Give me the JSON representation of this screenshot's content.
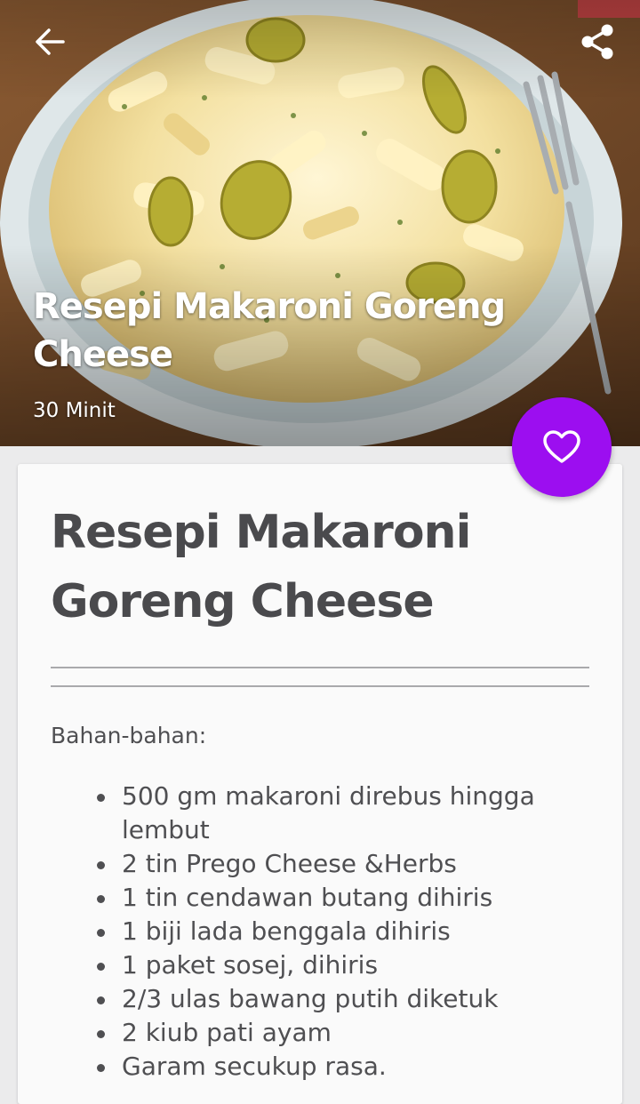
{
  "hero": {
    "title": "Resepi Makaroni Goreng Cheese",
    "duration": "30 Minit"
  },
  "toolbar": {
    "back_icon": "arrow-left-icon",
    "share_icon": "share-icon"
  },
  "favorite": {
    "icon": "heart-outline-icon",
    "color": "#9c0ef0"
  },
  "recipe": {
    "title": "Resepi Makaroni Goreng Cheese",
    "ingredients_label": "Bahan-bahan:",
    "ingredients": [
      "500 gm makaroni direbus hingga lembut",
      "2 tin Prego Cheese &Herbs",
      "1 tin cendawan butang dihiris",
      "1 biji lada benggala dihiris",
      "1 paket sosej, dihiris",
      "2/3 ulas bawang putih diketuk",
      "2 kiub pati ayam",
      "Garam secukup rasa."
    ]
  }
}
